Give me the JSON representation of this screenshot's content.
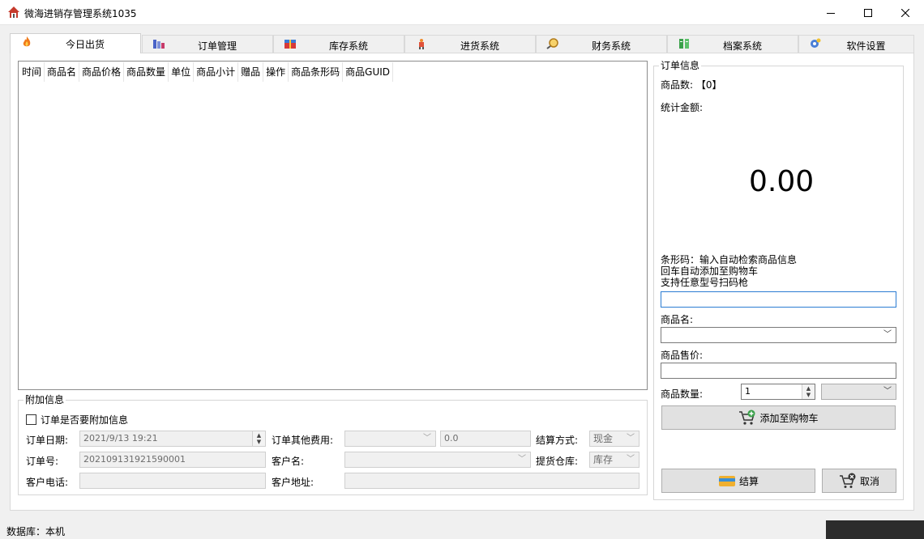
{
  "window": {
    "title": "微海进销存管理系统1035"
  },
  "tabs": [
    {
      "label": "今日出货",
      "icon": "fire-icon",
      "active": true
    },
    {
      "label": "订单管理",
      "icon": "books-icon"
    },
    {
      "label": "库存系统",
      "icon": "gift-box-icon"
    },
    {
      "label": "进货系统",
      "icon": "delivery-icon"
    },
    {
      "label": "财务系统",
      "icon": "magnifier-icon"
    },
    {
      "label": "档案系统",
      "icon": "archive-icon"
    },
    {
      "label": "软件设置",
      "icon": "gear-icon"
    }
  ],
  "grid": {
    "columns": [
      "时间",
      "商品名",
      "商品价格",
      "商品数量",
      "单位",
      "商品小计",
      "赠品",
      "操作",
      "商品条形码",
      "商品GUID"
    ]
  },
  "extra": {
    "legend": "附加信息",
    "attach_checkbox": {
      "label": "订单是否要附加信息",
      "checked": false
    },
    "order_date_label": "订单日期:",
    "order_date_value": "2021/9/13 19:21",
    "other_fee_label": "订单其他费用:",
    "other_fee_value": "0.0",
    "payment_label": "结算方式:",
    "payment_value": "现金",
    "order_no_label": "订单号:",
    "order_no_value": "202109131921590001",
    "customer_name_label": "客户名:",
    "warehouse_label": "提货仓库:",
    "warehouse_value": "库存",
    "phone_label": "客户电话:",
    "address_label": "客户地址:"
  },
  "order_info": {
    "legend": "订单信息",
    "count_label": "商品数:",
    "count_value": "【0】",
    "total_label": "统计金额:",
    "total_value": "0.00",
    "barcode_hint": [
      "条形码：输入自动检索商品信息",
      "回车自动添加至购物车",
      "支持任意型号扫码枪"
    ],
    "name_label": "商品名:",
    "price_label": "商品售价:",
    "qty_label": "商品数量:",
    "qty_value": "1",
    "add_button": "添加至购物车",
    "checkout_button": "结算",
    "cancel_button": "取消"
  },
  "statusbar": {
    "text": "数据库：本机"
  },
  "colors": {
    "accent_border": "#2b7cd3",
    "tab_border": "#d9d9d9"
  }
}
